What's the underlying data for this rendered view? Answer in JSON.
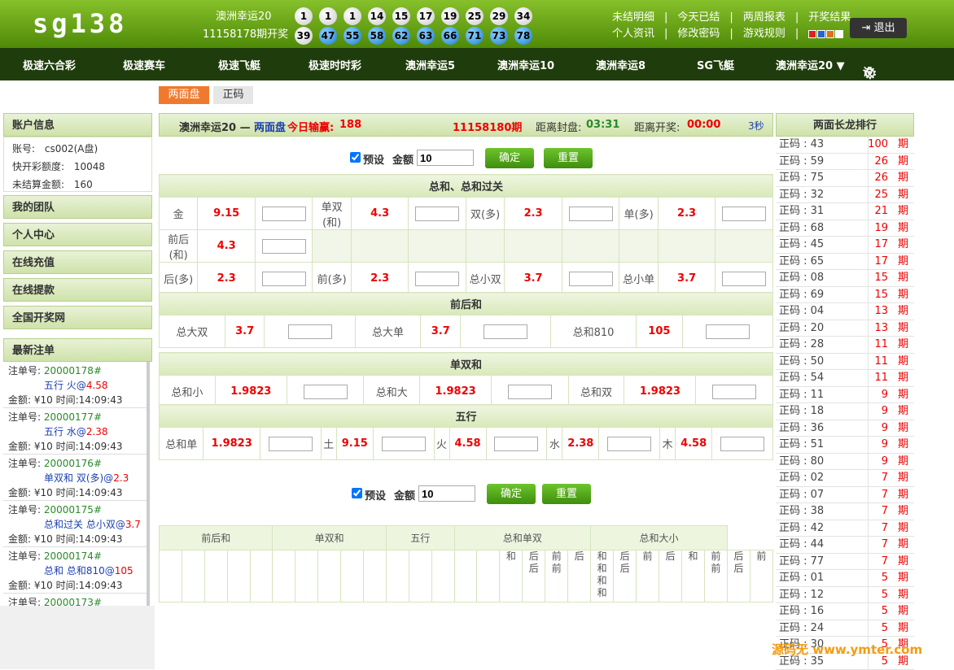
{
  "header": {
    "logo": "sg138",
    "game_name": "澳洲幸运20",
    "issue_label": "11158178期开奖",
    "balls": [
      {
        "n": "1",
        "c": "w"
      },
      {
        "n": "1",
        "c": "w"
      },
      {
        "n": "1",
        "c": "w"
      },
      {
        "n": "14",
        "c": "w"
      },
      {
        "n": "15",
        "c": "w"
      },
      {
        "n": "17",
        "c": "w"
      },
      {
        "n": "19",
        "c": "w"
      },
      {
        "n": "25",
        "c": "w"
      },
      {
        "n": "29",
        "c": "w"
      },
      {
        "n": "34",
        "c": "w"
      },
      {
        "n": "39",
        "c": "w"
      },
      {
        "n": "47",
        "c": "b"
      },
      {
        "n": "55",
        "c": "b"
      },
      {
        "n": "58",
        "c": "b"
      },
      {
        "n": "62",
        "c": "b"
      },
      {
        "n": "63",
        "c": "b"
      },
      {
        "n": "66",
        "c": "b"
      },
      {
        "n": "71",
        "c": "b"
      },
      {
        "n": "73",
        "c": "b"
      },
      {
        "n": "78",
        "c": "b"
      }
    ],
    "links_row1": [
      "未结明细",
      "今天已结",
      "两周报表",
      "开奖结果"
    ],
    "links_row2": [
      "个人资讯",
      "修改密码",
      "游戏规则"
    ],
    "swatch_colors": [
      "#e02020",
      "#3060d0",
      "#e07020",
      "#ffffff"
    ],
    "logout": "退出"
  },
  "nav": {
    "items": [
      "极速六合彩",
      "极速赛车",
      "极速飞艇",
      "极速时时彩",
      "澳洲幸运5",
      "澳洲幸运10",
      "澳洲幸运8",
      "SG飞艇",
      "澳洲幸运20 ▼"
    ],
    "settings": "设置"
  },
  "tabs": [
    "两面盘",
    "正码"
  ],
  "left": {
    "account_title": "账户信息",
    "account_rows": [
      {
        "k": "账号:",
        "v": "cs002(A盘)"
      },
      {
        "k": "快开彩额度:",
        "v": "10048"
      },
      {
        "k": "未结算金额:",
        "v": "160"
      }
    ],
    "menu": [
      "我的团队",
      "个人中心",
      "在线充值",
      "在线提款",
      "全国开奖网"
    ],
    "latest_title": "最新注单",
    "bets": [
      {
        "no": "20000178#",
        "desc": "五行 火@",
        "odds": "4.58",
        "info": "金额: ¥10  时间:14:09:43"
      },
      {
        "no": "20000177#",
        "desc": "五行 水@",
        "odds": "2.38",
        "info": "金额: ¥10  时间:14:09:43"
      },
      {
        "no": "20000176#",
        "desc": "单双和 双(多)@",
        "odds": "2.3",
        "info": "金额: ¥10  时间:14:09:43"
      },
      {
        "no": "20000175#",
        "desc": "总和过关 总小双@",
        "odds": "3.7",
        "info": "金额: ¥10  时间:14:09:43"
      },
      {
        "no": "20000174#",
        "desc": "总和 总和810@",
        "odds": "105",
        "info": "金额: ¥10  时间:14:09:43"
      },
      {
        "no": "20000173#",
        "desc": "",
        "odds": "",
        "info": ""
      }
    ],
    "bet_no_label": "注单号: "
  },
  "main": {
    "game": "澳洲幸运20 —",
    "mode": "两面盘",
    "today_label": "今日输赢:",
    "today_value": "188",
    "period": "11158180期",
    "close_label": "距离封盘:",
    "close_time": "03:31",
    "open_label": "距离开奖:",
    "open_time": "00:00",
    "refresh": "3秒",
    "preset": "预设",
    "amount_label": "金额",
    "amount_value": "10",
    "confirm": "确定",
    "reset": "重置",
    "sec1": "总和、总和过关",
    "sec1_rows": [
      [
        [
          "金",
          "9.15"
        ],
        [
          "单双(和)",
          "4.3"
        ],
        [
          "双(多)",
          "2.3"
        ],
        [
          "单(多)",
          "2.3"
        ]
      ],
      [
        [
          "前后(和)",
          "4.3"
        ]
      ],
      [
        [
          "后(多)",
          "2.3"
        ],
        [
          "前(多)",
          "2.3"
        ],
        [
          "总小双",
          "3.7"
        ],
        [
          "总小单",
          "3.7"
        ]
      ]
    ],
    "sec2": "前后和",
    "sec2_row": [
      [
        "总大双",
        "3.7"
      ],
      [
        "总大单",
        "3.7"
      ],
      [
        "总和810",
        "105"
      ]
    ],
    "sec3": "单双和",
    "sec3_row": [
      [
        "总和小",
        "1.9823"
      ],
      [
        "总和大",
        "1.9823"
      ],
      [
        "总和双",
        "1.9823"
      ]
    ],
    "sec4": "五行",
    "sec4_row": [
      [
        "总和单",
        "1.9823"
      ],
      [
        "土",
        "9.15"
      ],
      [
        "火",
        "4.58"
      ],
      [
        "水",
        "2.38"
      ],
      [
        "木",
        "4.58"
      ]
    ],
    "bottom_headers": [
      "前后和",
      "单双和",
      "五行",
      "总和单双",
      "总和大小"
    ],
    "bottom_cells": [
      "",
      "",
      "",
      "",
      "",
      "",
      "",
      "",
      "",
      "",
      "",
      "",
      "",
      "",
      "",
      "和",
      "后后",
      "前前",
      "后",
      "和和和和",
      "后后",
      "前",
      "后",
      "和",
      "前前",
      "后后",
      "前"
    ]
  },
  "right": {
    "title": "两面长龙排行",
    "rows": [
      {
        "k": "正码 : 43",
        "v": "100",
        "u": "期"
      },
      {
        "k": "正码 : 59",
        "v": "26",
        "u": "期"
      },
      {
        "k": "正码 : 75",
        "v": "26",
        "u": "期"
      },
      {
        "k": "正码 : 32",
        "v": "25",
        "u": "期"
      },
      {
        "k": "正码 : 31",
        "v": "21",
        "u": "期"
      },
      {
        "k": "正码 : 68",
        "v": "19",
        "u": "期"
      },
      {
        "k": "正码 : 45",
        "v": "17",
        "u": "期"
      },
      {
        "k": "正码 : 65",
        "v": "17",
        "u": "期"
      },
      {
        "k": "正码 : 08",
        "v": "15",
        "u": "期"
      },
      {
        "k": "正码 : 69",
        "v": "15",
        "u": "期"
      },
      {
        "k": "正码 : 04",
        "v": "13",
        "u": "期"
      },
      {
        "k": "正码 : 20",
        "v": "13",
        "u": "期"
      },
      {
        "k": "正码 : 28",
        "v": "11",
        "u": "期"
      },
      {
        "k": "正码 : 50",
        "v": "11",
        "u": "期"
      },
      {
        "k": "正码 : 54",
        "v": "11",
        "u": "期"
      },
      {
        "k": "正码 : 11",
        "v": "9",
        "u": "期"
      },
      {
        "k": "正码 : 18",
        "v": "9",
        "u": "期"
      },
      {
        "k": "正码 : 36",
        "v": "9",
        "u": "期"
      },
      {
        "k": "正码 : 51",
        "v": "9",
        "u": "期"
      },
      {
        "k": "正码 : 80",
        "v": "9",
        "u": "期"
      },
      {
        "k": "正码 : 02",
        "v": "7",
        "u": "期"
      },
      {
        "k": "正码 : 07",
        "v": "7",
        "u": "期"
      },
      {
        "k": "正码 : 38",
        "v": "7",
        "u": "期"
      },
      {
        "k": "正码 : 42",
        "v": "7",
        "u": "期"
      },
      {
        "k": "正码 : 44",
        "v": "7",
        "u": "期"
      },
      {
        "k": "正码 : 77",
        "v": "7",
        "u": "期"
      },
      {
        "k": "正码 : 01",
        "v": "5",
        "u": "期"
      },
      {
        "k": "正码 : 12",
        "v": "5",
        "u": "期"
      },
      {
        "k": "正码 : 16",
        "v": "5",
        "u": "期"
      },
      {
        "k": "正码 : 24",
        "v": "5",
        "u": "期"
      },
      {
        "k": "正码 : 30",
        "v": "5",
        "u": "期"
      },
      {
        "k": "正码 : 35",
        "v": "5",
        "u": "期"
      }
    ]
  },
  "watermark": "源码无 www.ymter.com"
}
